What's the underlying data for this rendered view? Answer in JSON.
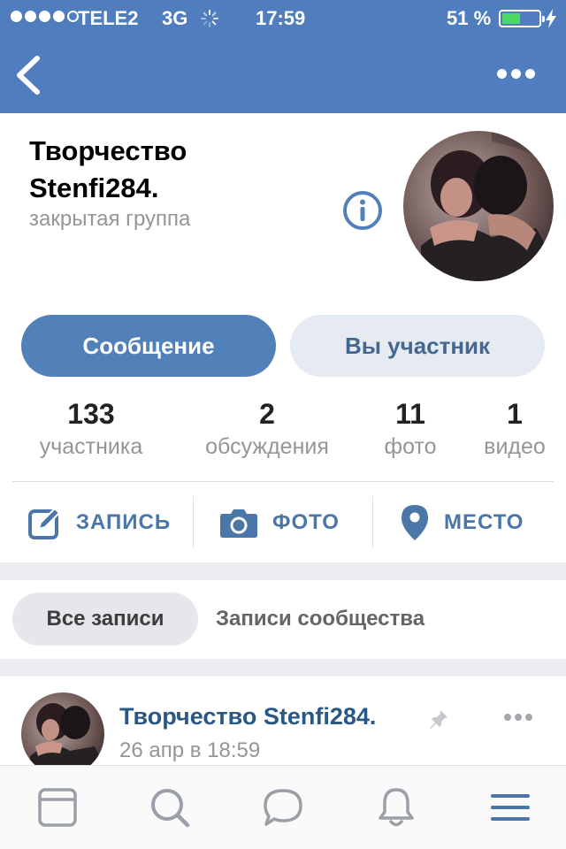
{
  "status_bar": {
    "carrier": "TELE2",
    "network": "3G",
    "time": "17:59",
    "battery": "51 %",
    "battery_level": 0.51,
    "signal_bars": 4,
    "signal_total": 5
  },
  "header": {
    "title": "Творчество Stenfi284.",
    "subtitle": "закрытая группа"
  },
  "buttons": {
    "message": "Сообщение",
    "member": "Вы участник"
  },
  "counters": [
    {
      "value": "133",
      "label": "участника"
    },
    {
      "value": "2",
      "label": "обсуждения"
    },
    {
      "value": "11",
      "label": "фото"
    },
    {
      "value": "1",
      "label": "видео"
    }
  ],
  "actions": {
    "post": "ЗАПИСЬ",
    "photo": "ФОТО",
    "place": "МЕСТО"
  },
  "filters": {
    "all": "Все записи",
    "community": "Записи сообщества"
  },
  "post": {
    "author": "Творчество Stenfi284.",
    "date": "26 апр в 18:59"
  },
  "colors": {
    "brand": "#4f7dbd",
    "primary_button": "#5181b8",
    "link": "#2a5885",
    "muted": "#939699"
  },
  "icons": {
    "back": "chevron-left-icon",
    "more": "ellipsis-icon",
    "info": "info-icon",
    "post": "edit-icon",
    "photo": "camera-icon",
    "place": "map-pin-icon",
    "pin": "pin-icon",
    "tab_news": "newsfeed-icon",
    "tab_search": "search-icon",
    "tab_messages": "messages-icon",
    "tab_notifications": "bell-icon",
    "tab_menu": "menu-icon"
  }
}
